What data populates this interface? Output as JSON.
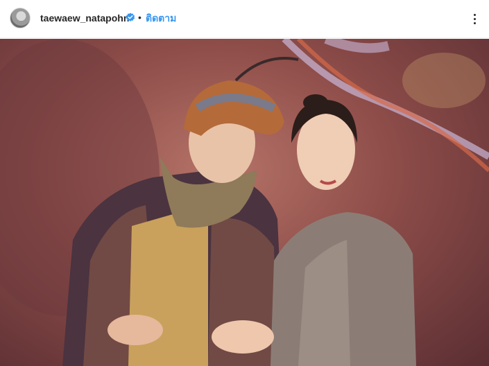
{
  "post_header": {
    "username": "taewaew_natapohn",
    "separator": "•",
    "follow_label": "ติดตาม",
    "avatar_icon": "profile-avatar",
    "verified_icon": "verified-badge-icon",
    "more_icon": "more-options-icon"
  },
  "colors": {
    "follow_link": "#3897f0",
    "verified_badge": "#3897f0",
    "text": "#262626"
  },
  "photo": {
    "subject": "couple-in-traditional-costume"
  }
}
